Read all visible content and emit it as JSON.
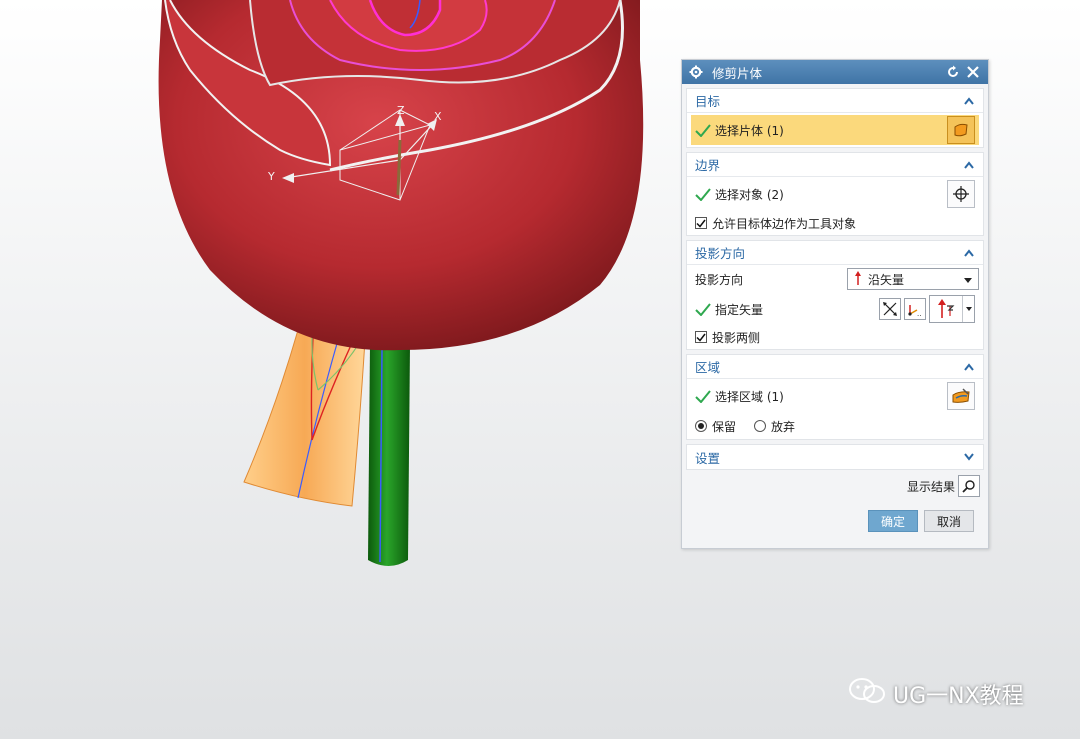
{
  "dialog": {
    "title": "修剪片体",
    "sections": {
      "target": {
        "header": "目标",
        "select_label": "选择片体 (1)"
      },
      "boundary": {
        "header": "边界",
        "select_label": "选择对象 (2)",
        "allow_edge_label": "允许目标体边作为工具对象",
        "allow_edge_checked": true
      },
      "projection": {
        "header": "投影方向",
        "direction_label": "投影方向",
        "direction_value": "沿矢量",
        "vector_label": "指定矢量",
        "both_sides_label": "投影两侧",
        "both_sides_checked": true
      },
      "region": {
        "header": "区域",
        "select_label": "选择区域 (1)",
        "keep_label": "保留",
        "discard_label": "放弃",
        "selected": "keep"
      },
      "settings": {
        "header": "设置"
      }
    },
    "show_result_label": "显示结果",
    "ok_label": "确定",
    "cancel_label": "取消"
  },
  "viewport": {
    "axis_labels": {
      "x": "X",
      "y": "Y",
      "z": "Z"
    }
  },
  "watermark": {
    "text": "UG一NX教程"
  },
  "colors": {
    "title_bar": "#4a7fb1",
    "section_header_text": "#2c69a5",
    "selected_row": "#fbd97c",
    "check_green": "#2fa84f",
    "rose_red": "#b8282d",
    "stem_green": "#1f8a1f",
    "leaf_orange": "#f9b76a"
  }
}
